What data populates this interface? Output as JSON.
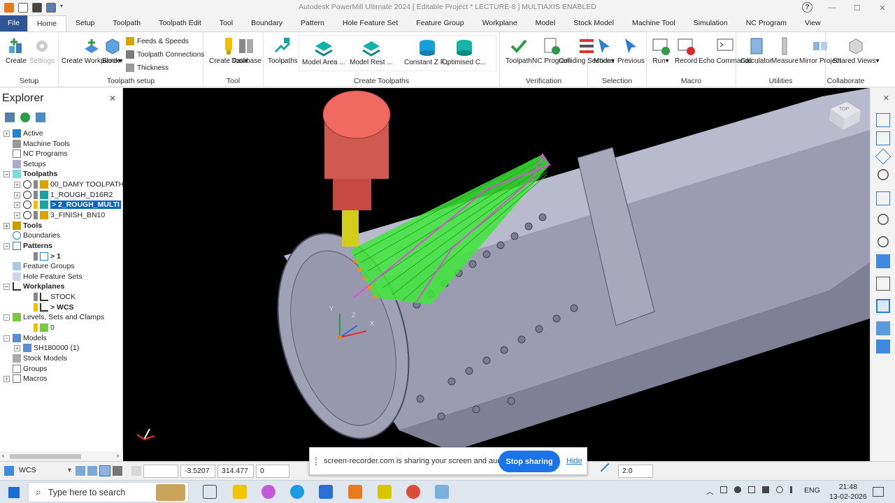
{
  "window": {
    "title": "Autodesk PowerMill Ultimate 2024   [ Editable Project * LECTURE-8 ]   MULTIAXIS ENABLED",
    "help": "?",
    "min": "—",
    "max": "☐",
    "close": "✕"
  },
  "tabs": [
    "File",
    "Home",
    "Setup",
    "Toolpath",
    "Toolpath Edit",
    "Tool",
    "Boundary",
    "Pattern",
    "Hole Feature Set",
    "Feature Group",
    "Workplane",
    "Model",
    "Stock Model",
    "Machine Tool",
    "Simulation",
    "NC Program",
    "View"
  ],
  "active_tab": "Home",
  "ribbon": {
    "setup": {
      "label": "Setup",
      "create": "Create",
      "settings": "Settings"
    },
    "toolpath_setup": {
      "label": "Toolpath setup",
      "create_workplane": "Create Workplane",
      "block": "Block",
      "feeds": "Feeds & Speeds",
      "connections": "Toolpath Connections",
      "thickness": "Thickness"
    },
    "tool": {
      "label": "Tool",
      "create_tool": "Create Tool",
      "database": "Database"
    },
    "create_toolpaths": {
      "label": "Create Toolpaths",
      "toolpaths": "Toolpaths",
      "model_area": "Model Area ...",
      "model_rest": "Model Rest ...",
      "constant_z": "Constant Z F...",
      "optimised": "Optimised C..."
    },
    "verification": {
      "label": "Verification",
      "toolpath": "Toolpath",
      "nc_program": "NC Program",
      "colliding": "Colliding Sections"
    },
    "selection": {
      "label": "Selection",
      "mode": "Mode",
      "previous": "Previous"
    },
    "macro": {
      "label": "Macro",
      "run": "Run",
      "record": "Record",
      "echo": "Echo Commands"
    },
    "utilities": {
      "label": "Utilities",
      "calculator": "Calculator",
      "measure": "Measure",
      "mirror": "Mirror Project"
    },
    "collaborate": {
      "label": "Collaborate",
      "shared": "Shared Views"
    }
  },
  "explorer": {
    "title": "Explorer",
    "items": [
      {
        "label": "Active"
      },
      {
        "label": "Machine Tools"
      },
      {
        "label": "NC Programs"
      },
      {
        "label": "Setups"
      },
      {
        "label": "Toolpaths"
      },
      {
        "label": "00_DAMY TOOLPATH"
      },
      {
        "label": "1_ROUGH_D16R2"
      },
      {
        "label": "> 2_ROUGH_MULTI"
      },
      {
        "label": "3_FINISH_BN10"
      },
      {
        "label": "Tools"
      },
      {
        "label": "Boundaries"
      },
      {
        "label": "Patterns"
      },
      {
        "label": "> 1"
      },
      {
        "label": "Feature Groups"
      },
      {
        "label": "Hole Feature Sets"
      },
      {
        "label": "Workplanes"
      },
      {
        "label": "STOCK"
      },
      {
        "label": "> WCS"
      },
      {
        "label": "Levels, Sets and Clamps"
      },
      {
        "label": "0"
      },
      {
        "label": "Models"
      },
      {
        "label": "SH180000 (1)"
      },
      {
        "label": "Stock Models"
      },
      {
        "label": "Groups"
      },
      {
        "label": "Macros"
      }
    ]
  },
  "viewport": {
    "axis_x": "X",
    "axis_y": "Y",
    "axis_z": "Z",
    "cube": "TOP"
  },
  "status": {
    "workplane": "WCS",
    "x": "-3.5207",
    "y": "314.477",
    "z": "0",
    "tol": "2.0"
  },
  "share_banner": {
    "message": "screen-recorder.com is sharing your screen and audio.",
    "stop": "Stop sharing",
    "hide": "Hide"
  },
  "taskbar": {
    "search": "Type here to search",
    "lang": "ENG",
    "time": "21:48",
    "date": "13-02-2026"
  }
}
